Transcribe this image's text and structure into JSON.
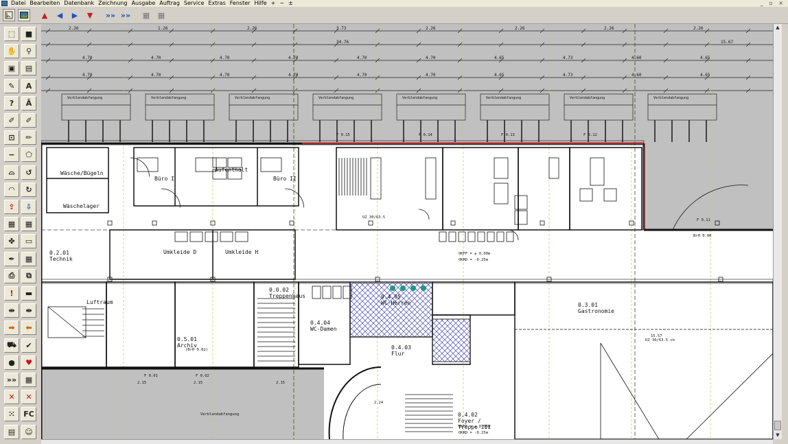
{
  "menu": {
    "items": [
      "Datei",
      "Bearbeiten",
      "Datenbank",
      "Zeichnung",
      "Ausgabe",
      "Auftrag",
      "Service",
      "Extras",
      "Fenster",
      "Hilfe",
      "+",
      "−",
      "±"
    ],
    "window_controls": "_ ▫ ×"
  },
  "toolbar": {
    "buttons": [
      {
        "icon": "save-arrow-icon",
        "glyph": "▲",
        "color": "#c02020"
      },
      {
        "icon": "move-left-icon",
        "glyph": "◀",
        "color": "#2050c0"
      },
      {
        "icon": "move-right-icon",
        "glyph": "▶",
        "color": "#2050c0"
      },
      {
        "icon": "load-arrow-icon",
        "glyph": "▼",
        "color": "#c02020"
      },
      {
        "icon": "forward-icon",
        "glyph": "»»",
        "color": "#2050c0"
      },
      {
        "icon": "forward-alt-icon",
        "glyph": "»»",
        "color": "#2050c0"
      },
      {
        "icon": "grid-icon",
        "glyph": "▦",
        "color": "#777777"
      },
      {
        "icon": "grid-alt-icon",
        "glyph": "▦",
        "color": "#777777"
      }
    ]
  },
  "left_tools": [
    {
      "icon": "select-icon",
      "glyph": "⬚"
    },
    {
      "icon": "layer-icon",
      "glyph": "■"
    },
    {
      "icon": "hand-pan-icon",
      "glyph": "✋"
    },
    {
      "icon": "zoom-icon",
      "glyph": "⚲"
    },
    {
      "icon": "photo-icon",
      "glyph": "▣"
    },
    {
      "icon": "calculator-icon",
      "glyph": "▤"
    },
    {
      "icon": "pencil-icon",
      "glyph": "✎"
    },
    {
      "icon": "text-icon",
      "glyph": "A"
    },
    {
      "icon": "help-icon",
      "glyph": "?"
    },
    {
      "icon": "text-style-icon",
      "glyph": "Ā"
    },
    {
      "icon": "edit-icon",
      "glyph": "✐"
    },
    {
      "icon": "edit-alt-icon",
      "glyph": "✐"
    },
    {
      "icon": "dimension-icon",
      "glyph": "⊡"
    },
    {
      "icon": "sketch-icon",
      "glyph": "✏"
    },
    {
      "icon": "line-icon",
      "glyph": "−"
    },
    {
      "icon": "shape-icon",
      "glyph": "⬠"
    },
    {
      "icon": "arc-icon",
      "glyph": "⌓"
    },
    {
      "icon": "curve-icon",
      "glyph": "↺"
    },
    {
      "icon": "ellipse-icon",
      "glyph": "◠"
    },
    {
      "icon": "rotate-icon",
      "glyph": "↻"
    },
    {
      "icon": "export-icon",
      "glyph": "⇪"
    },
    {
      "icon": "import-icon",
      "glyph": "⇩"
    },
    {
      "icon": "value-icon",
      "glyph": "▦"
    },
    {
      "icon": "value-alt-icon",
      "glyph": "▦"
    },
    {
      "icon": "node-icon",
      "glyph": "✤"
    },
    {
      "icon": "window-icon",
      "glyph": "▭"
    },
    {
      "icon": "brush-icon",
      "glyph": "✒"
    },
    {
      "icon": "fill-icon",
      "glyph": "▦"
    },
    {
      "icon": "print-icon",
      "glyph": "⎙"
    },
    {
      "icon": "copy-icon",
      "glyph": "⧉"
    },
    {
      "icon": "warning-icon",
      "glyph": "!"
    },
    {
      "icon": "panel-icon",
      "glyph": "▬"
    },
    {
      "icon": "split-icon",
      "glyph": "⇹"
    },
    {
      "icon": "merge-icon",
      "glyph": "⇼"
    },
    {
      "icon": "arrow-right-icon",
      "glyph": "➡"
    },
    {
      "icon": "arrow-left-icon",
      "glyph": "⬅"
    },
    {
      "icon": "cart-icon",
      "glyph": "⛟"
    },
    {
      "icon": "check-icon",
      "glyph": "✔"
    },
    {
      "icon": "bomb-icon",
      "glyph": "●"
    },
    {
      "icon": "heart-icon",
      "glyph": "♥"
    },
    {
      "icon": "fast-forward-icon",
      "glyph": "»»"
    },
    {
      "icon": "grid-small-icon",
      "glyph": "▦"
    },
    {
      "icon": "cross-icon",
      "glyph": "✕"
    },
    {
      "icon": "cross-alt-icon",
      "glyph": "✕"
    },
    {
      "icon": "dots-icon",
      "glyph": "⁙"
    },
    {
      "icon": "fc-icon",
      "glyph": "FC"
    },
    {
      "icon": "table-icon",
      "glyph": "▤"
    },
    {
      "icon": "smiley-icon",
      "glyph": "☺"
    }
  ],
  "drawing": {
    "dims_row1": [
      "2.26",
      "1.26",
      "2.26",
      "3.73",
      "2.26",
      "2.26",
      "2.26",
      "2.26"
    ],
    "dims_total": [
      "34.76",
      "15.67"
    ],
    "dims_row2": [
      "4.70",
      "4.70",
      "4.70",
      "4.70",
      "4.70",
      "4.70",
      "4.65",
      "4.73",
      "4.60",
      "4.65"
    ],
    "verblend": [
      "Verblendabfangung",
      "Verblendabfangung",
      "Verblendabfangung",
      "Verblendabfangung",
      "Verblendabfangung",
      "Verblendabfangung",
      "Verblendabfangung",
      "Verblendabfangung"
    ],
    "rooms": {
      "waesche": "Wäsche/Bügeln",
      "waeschelager": "Wäschelager",
      "buero1": "Büro I",
      "aufenthalt": "Aufenthalt",
      "buero2": "Büro II",
      "technik": "0.2.01\nTechnik",
      "umkleide_d": "Umkleide D",
      "umkleide_h": "Umkleide H",
      "treppe": "0.0.02\nTreppenhaus",
      "archiv": "0.5.01\nArchiv",
      "wc_damen": "0.4.04\nWC-Damen",
      "wc_herren": "0.4.05\nWC-Herren",
      "flur": "0.4.03\nFlur",
      "gastronomie": "0.3.01\nGastronomie",
      "foyer": "0.4.02\nFoyer /\nTreppe III",
      "luftraum": "Luftraum"
    },
    "annotations": {
      "brh_lines": [
        "BrH 0.00",
        "BrH 0.82",
        "(BrH 0.82)"
      ],
      "uz": "UZ 30/63.5 ch",
      "uz2": "UZ 30/63.5",
      "ok_ff": "OKFF = ± 0.00m",
      "okrd": "OKRD = -0.25m",
      "bottom_dims": [
        "2.15",
        "2.15",
        "2.15"
      ],
      "f_labels": [
        "F 0.15",
        "F 0.14",
        "F 0.13",
        "F 0.12",
        "F 0.11",
        "F 0.01",
        "F 0.02"
      ],
      "misc": [
        "15.57",
        "Verblendabfangung",
        "2.24",
        "1.6",
        "0.06"
      ]
    }
  }
}
